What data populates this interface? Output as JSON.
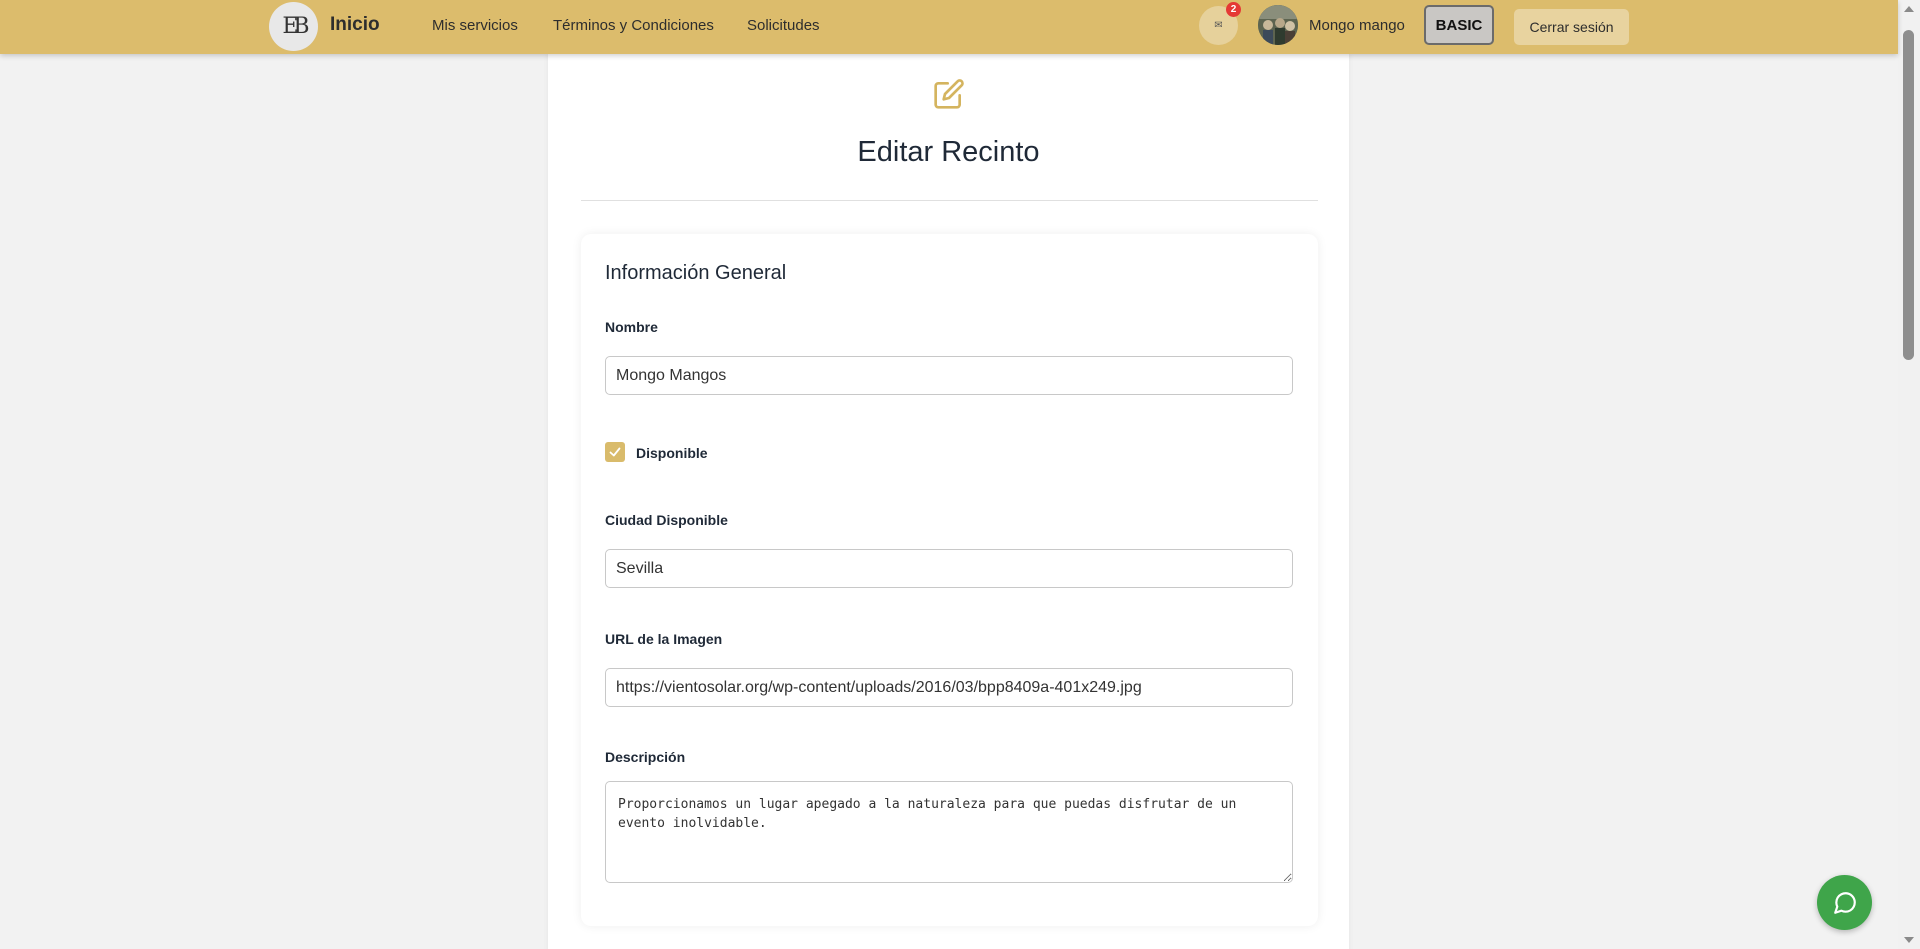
{
  "navbar": {
    "logo_text": "EB",
    "brand": "Inicio",
    "links": [
      "Mis servicios",
      "Términos y Condiciones",
      "Solicitudes"
    ],
    "mail_icon_glyph": "✉",
    "notification_count": "2",
    "username": "Mongo mango",
    "plan": "BASIC",
    "logout_label": "Cerrar sesión"
  },
  "page": {
    "title": "Editar Recinto",
    "section_title": "Información General"
  },
  "form": {
    "name_label": "Nombre",
    "name_value": "Mongo Mangos",
    "available_label": "Disponible",
    "available_checked": true,
    "city_label": "Ciudad Disponible",
    "city_value": "Sevilla",
    "image_url_label": "URL de la Imagen",
    "image_url_value": "https://vientosolar.org/wp-content/uploads/2016/03/bpp8409a-401x249.jpg",
    "description_label": "Descripción",
    "description_value": "Proporcionamos un lugar apegado a la naturaleza para que puedas disfrutar de un evento inolvidable."
  },
  "icons": {
    "edit": "edit-icon",
    "mail": "mail-icon",
    "check": "check-icon",
    "chat": "chat-icon"
  },
  "colors": {
    "navbar": "#dcbc6c",
    "accent": "#d9bb6b",
    "chat_button": "#3fa54a",
    "badge": "#e53935"
  }
}
